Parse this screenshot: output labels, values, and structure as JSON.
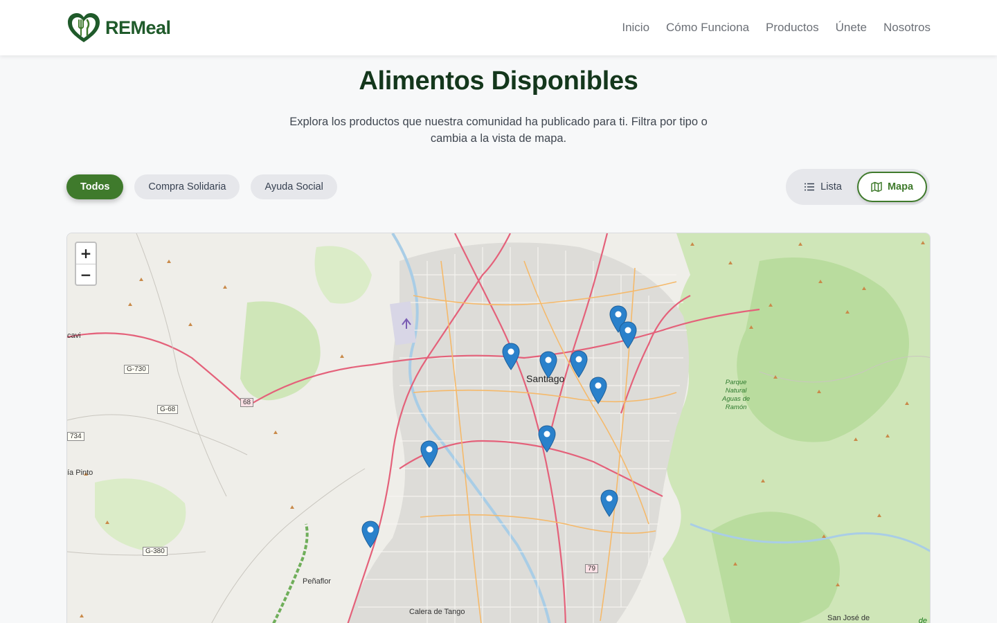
{
  "brand": {
    "name": "REMeal",
    "primary_color": "#3f7a2c",
    "dark_color": "#14371c"
  },
  "nav": [
    "Inicio",
    "Cómo Funciona",
    "Productos",
    "Únete",
    "Nosotros"
  ],
  "page": {
    "title": "Alimentos Disponibles",
    "subtitle": "Explora los productos que nuestra comunidad ha publicado para ti. Filtra por tipo o cambia a la vista de mapa."
  },
  "filters": {
    "items": [
      "Todos",
      "Compra Solidaria",
      "Ayuda Social"
    ],
    "selected": "Todos"
  },
  "view_toggle": {
    "list_label": "Lista",
    "map_label": "Mapa",
    "selected": "Mapa",
    "list_icon": "list-icon",
    "map_icon": "map-icon"
  },
  "map": {
    "zoom_in": "+",
    "zoom_out": "−",
    "marker_count": 10,
    "marker_color": "#2a81cb",
    "labels": {
      "city": "Santiago",
      "park": [
        "Parque",
        "Natural",
        "Aguas de",
        "Ramón"
      ],
      "places": [
        "Peñaflor",
        "Calera de Tango",
        "San José de",
        "ía Pinto",
        "cavi"
      ],
      "roads": [
        "G-730",
        "G-68",
        "68",
        "734",
        "G-380",
        "79"
      ]
    },
    "attribution": "de"
  }
}
